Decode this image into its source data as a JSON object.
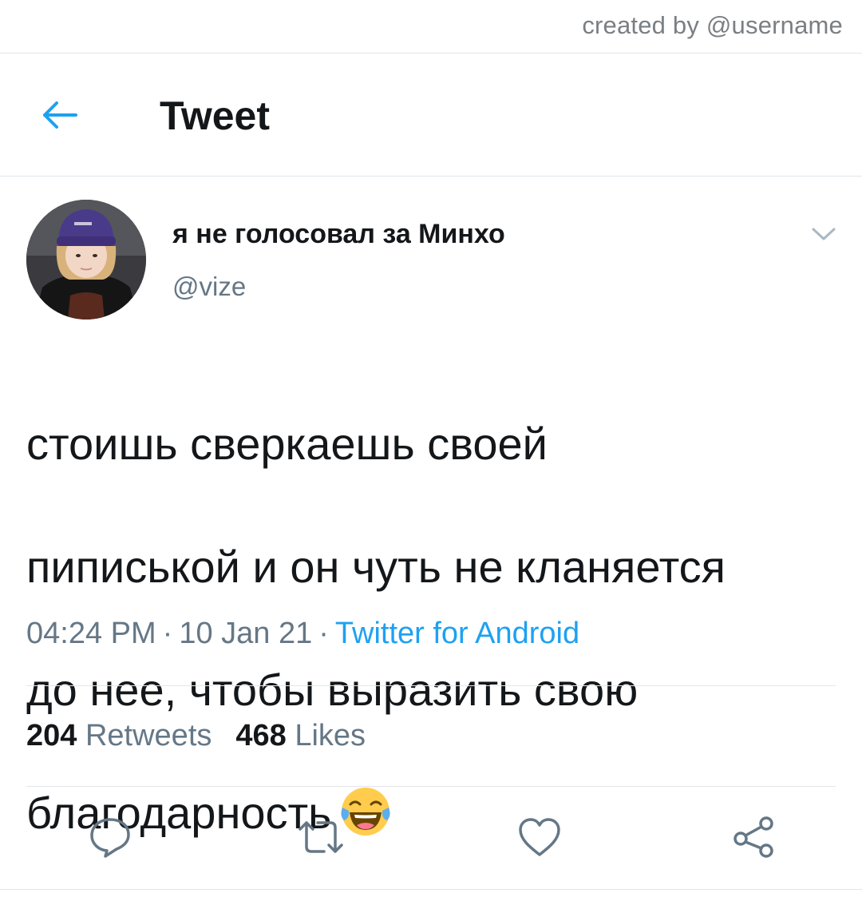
{
  "watermark": "created by @username",
  "header": {
    "title": "Tweet",
    "back_icon": "arrow-left-icon"
  },
  "author": {
    "display_name": "я не голосовал за Минхо",
    "handle": "@vize"
  },
  "tweet": {
    "lines": [
      "стоишь сверкаешь своей",
      "пиписькой и он чуть не кланяется",
      "до нее, чтобы выразить свою",
      "благодарность"
    ],
    "emoji": "face-with-tears-of-joy-icon"
  },
  "meta": {
    "time": "04:24 PM",
    "separator": "·",
    "date": "10 Jan 21",
    "source": "Twitter for Android"
  },
  "stats": {
    "retweets_count": "204",
    "retweets_label": "Retweets",
    "likes_count": "468",
    "likes_label": "Likes"
  },
  "actions": [
    "reply-icon",
    "retweet-icon",
    "like-icon",
    "share-icon"
  ],
  "colors": {
    "accent": "#1da1f2",
    "text_primary": "#14171a",
    "text_secondary": "#657786",
    "divider": "#e1e6ea"
  }
}
